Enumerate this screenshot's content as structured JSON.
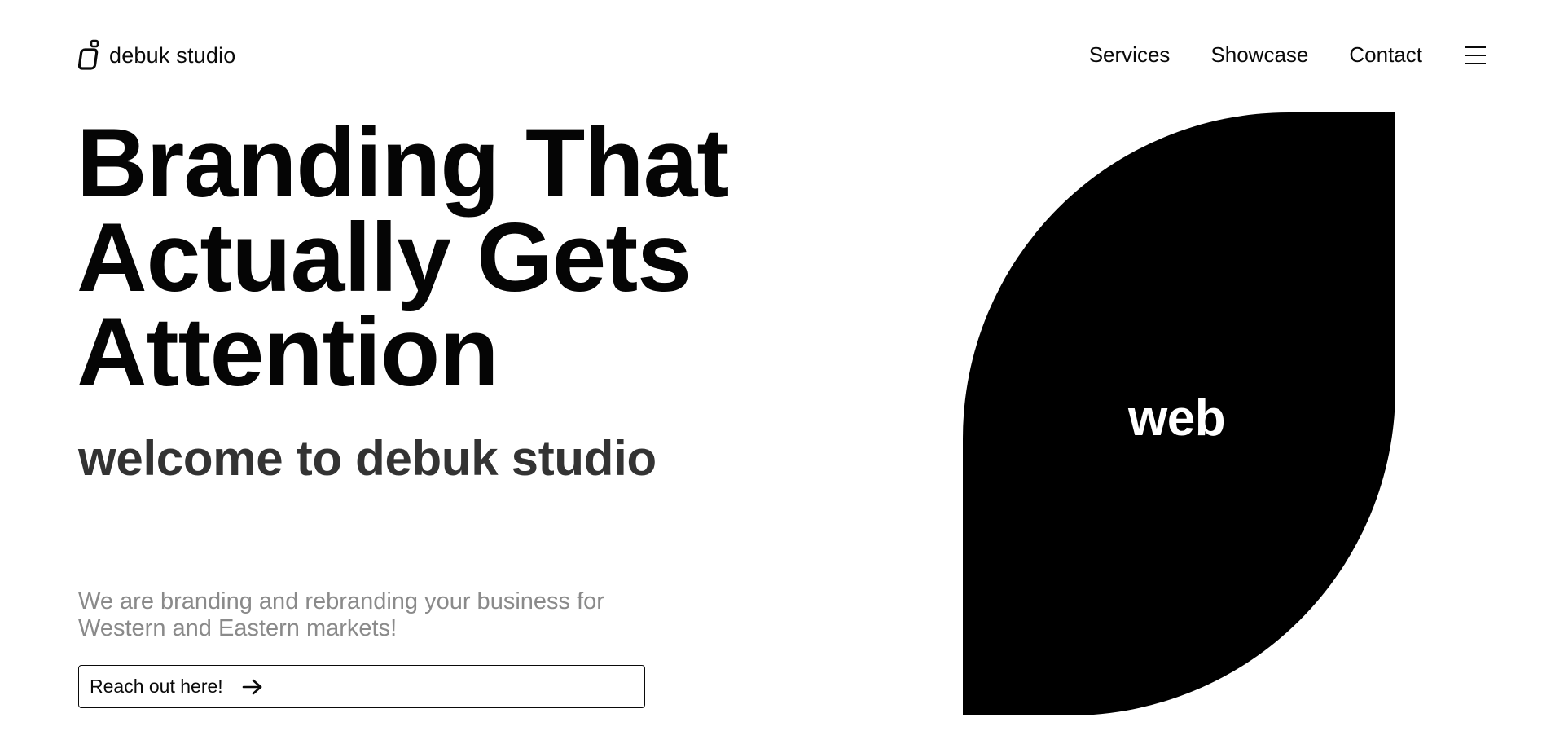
{
  "header": {
    "logo_text": "debuk studio",
    "logo_icon": "debuk-logo-mark",
    "nav": [
      {
        "label": "Services"
      },
      {
        "label": "Showcase"
      },
      {
        "label": "Contact"
      }
    ],
    "menu_icon": "hamburger-menu-icon"
  },
  "hero": {
    "headline_lines": [
      "Branding That",
      "Actually Gets",
      "Attention"
    ],
    "subheadline": "welcome to debuk studio",
    "tagline_lines": [
      "We are branding and rebranding your business for",
      "Western and Eastern markets!"
    ],
    "cta_label": "Reach out here!",
    "cta_icon": "arrow-right-icon"
  },
  "visual": {
    "label": "web",
    "shape_color": "#000000",
    "label_color": "#ffffff"
  },
  "colors": {
    "text": "#0a0a0a",
    "subheadline": "#333333",
    "tagline": "#8a8a8a",
    "background": "#ffffff"
  }
}
